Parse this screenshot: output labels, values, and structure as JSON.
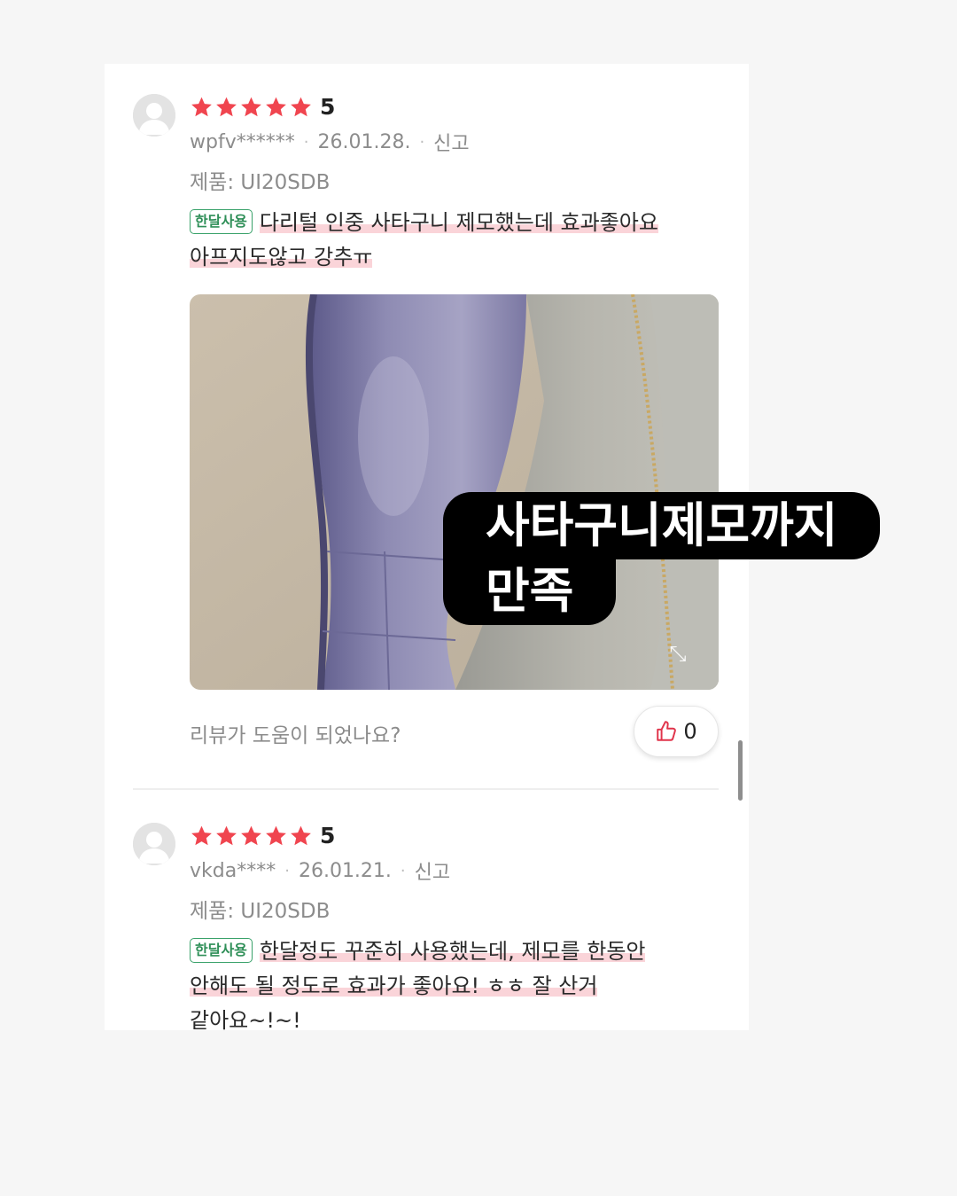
{
  "reviews": [
    {
      "rating": "5",
      "stars": 5,
      "user": "wpfv******",
      "date": "26.01.28.",
      "report": "신고",
      "product": "제품: UI20SDB",
      "badge": "한달사용",
      "text_part1": "다리털 인중 사타구니 제모했는데 효과좋아요",
      "text_part2": "아프지도않고 강추ㅠ",
      "has_photo": true
    },
    {
      "rating": "5",
      "stars": 5,
      "user": "vkda****",
      "date": "26.01.21.",
      "report": "신고",
      "product": "제품: UI20SDB",
      "badge": "한달사용",
      "text_part1": "한달정도 꾸준히 사용했는데, 제모를 한동안",
      "text_part2": "안해도 될 정도로 효과가 좋아요! ㅎㅎ 잘 산거",
      "text_part3": "같아요~!~!"
    }
  ],
  "helpful": {
    "question": "리뷰가 도움이 되었나요?",
    "count": "0"
  },
  "overlay_caption": {
    "line1": "사타구니제모까지",
    "line2": "만족"
  },
  "colors": {
    "star": "#f0454f",
    "badge": "#38a169",
    "highlight": "#f3a0aa",
    "caption_bg": "#000000"
  },
  "icons": [
    "avatar-icon",
    "star-icon",
    "expand-icon",
    "thumbs-up-icon"
  ]
}
